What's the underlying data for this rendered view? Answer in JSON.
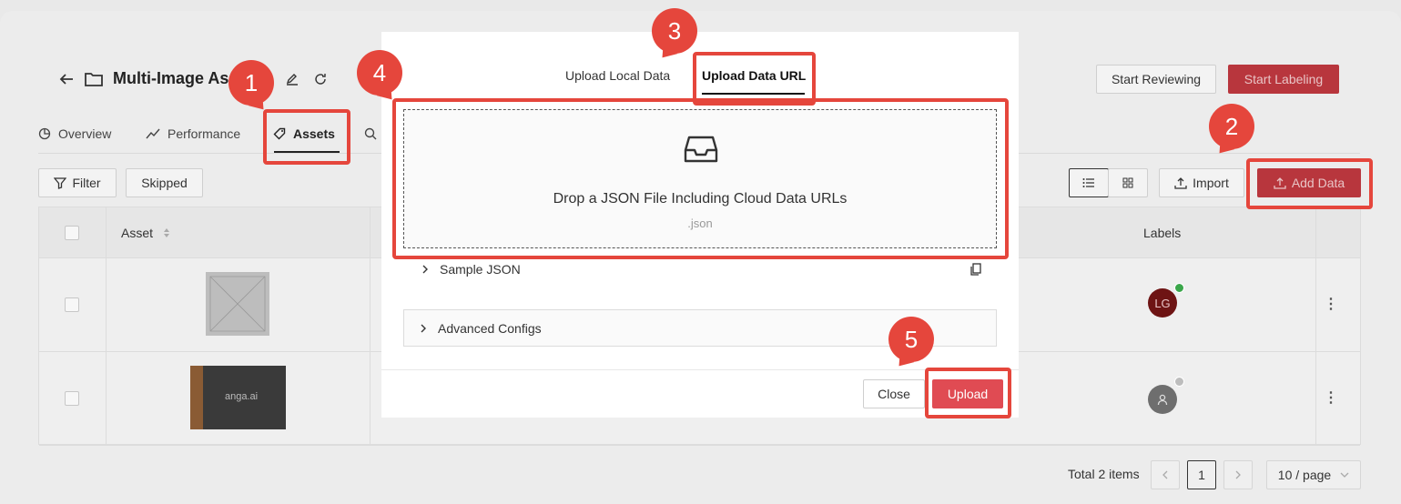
{
  "header": {
    "title": "Multi-Image Assets",
    "start_reviewing": "Start Reviewing",
    "start_labeling": "Start Labeling"
  },
  "tabs": [
    {
      "label": "Overview"
    },
    {
      "label": "Performance"
    },
    {
      "label": "Assets"
    }
  ],
  "toolbar": {
    "filter": "Filter",
    "skipped": "Skipped",
    "import": "Import",
    "add_data": "Add Data"
  },
  "table": {
    "columns": {
      "asset": "Asset",
      "labels": "Labels"
    },
    "rows": [
      {
        "label_avatar": "LG",
        "status_color": "#3aa64a"
      },
      {
        "label_avatar": "",
        "status_color": "#bdbdbd"
      }
    ],
    "thumb_text": "anga.ai"
  },
  "pagination": {
    "total": "Total 2 items",
    "current_page": "1",
    "page_size": "10 / page"
  },
  "modal": {
    "tab_local": "Upload Local Data",
    "tab_url": "Upload Data URL",
    "drop_text": "Drop a JSON File Including Cloud Data URLs",
    "drop_sub": ".json",
    "sample_json": "Sample JSON",
    "advanced": "Advanced Configs",
    "close": "Close",
    "upload": "Upload"
  },
  "annotations": {
    "step1": "1",
    "step2": "2",
    "step3": "3",
    "step4": "4",
    "step5": "5",
    "color": "#e5463c"
  }
}
